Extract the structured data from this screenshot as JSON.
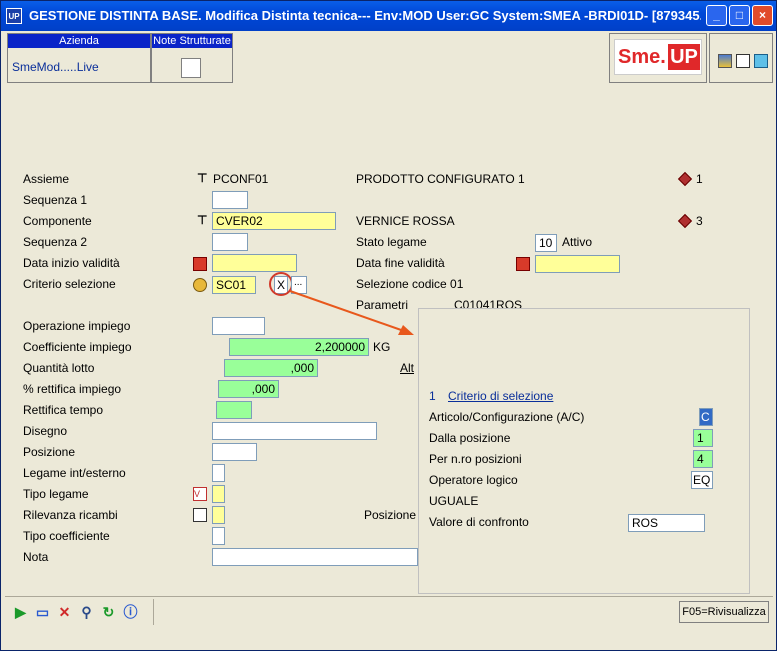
{
  "window": {
    "icon_label": "UP",
    "title": "GESTIONE DISTINTA BASE.  Modifica Distinta tecnica--- Env:MOD User:GC System:SMEA -BRDI01D- [879345..."
  },
  "header": {
    "azienda_label": "Azienda",
    "azienda_value": "SmeMod.....Live",
    "note_label": "Note Strutturate",
    "logo_text_a": "Sme.",
    "logo_text_b": "UP"
  },
  "form": {
    "assieme_label": "Assieme",
    "assieme_code": "PCONF01",
    "assieme_desc": "PRODOTTO CONFIGURATO 1",
    "assieme_qty": "1",
    "sequenza1_label": "Sequenza 1",
    "componente_label": "Componente",
    "componente_code": "CVER02",
    "componente_desc": "VERNICE ROSSA",
    "componente_qty": "3",
    "sequenza2_label": "Sequenza 2",
    "stato_legame_label": "Stato legame",
    "stato_legame_value": "10",
    "stato_legame_text": "Attivo",
    "data_inizio_label": "Data inizio validità",
    "data_fine_label": "Data fine validità",
    "criterio_label": "Criterio selezione",
    "criterio_value": "SC01",
    "criterio_x": "X",
    "criterio_more": "...",
    "selezione_codice": "Selezione codice 01",
    "parametri_label": "Parametri",
    "parametri_value": "C01041ROS",
    "operazione_label": "Operazione impiego",
    "coeff_label": "Coefficiente impiego",
    "coeff_value": "2,200000",
    "coeff_unit": "KG",
    "qta_lotto_label": "Quantità lotto",
    "qta_lotto_value": ",000",
    "alt_label": "Alt",
    "rettifica_label": "% rettifica impiego",
    "rettifica_value": ",000",
    "rettifica_tempo_label": "Rettifica tempo",
    "disegno_label": "Disegno",
    "posizione_label": "Posizione",
    "legame_label": "Legame int/esterno",
    "tipo_legame_label": "Tipo legame",
    "rilevanza_label": "Rilevanza ricambi",
    "posizione2_label": "Posizione",
    "tipo_coeff_label": "Tipo coefficiente",
    "nota_label": "Nota"
  },
  "popup": {
    "title_num": "1",
    "title_link": "Criterio di selezione",
    "articolo_label": "Articolo/Configurazione (A/C)",
    "articolo_value": "C",
    "dalla_label": "Dalla posizione",
    "dalla_value": "1",
    "pernro_label": "Per n.ro posizioni",
    "pernro_value": "4",
    "operatore_label": "Operatore logico",
    "operatore_value": "EQ",
    "uguale_label": "UGUALE",
    "valore_label": "Valore di confronto",
    "valore_value": "ROS"
  },
  "statusbar": {
    "f05_label": "F05=Rivisualizza"
  },
  "colors": {
    "accent": "#e8581c",
    "yellow_field": "#ffff99",
    "green_field": "#99ff99",
    "title_blue": "#0048d8"
  }
}
